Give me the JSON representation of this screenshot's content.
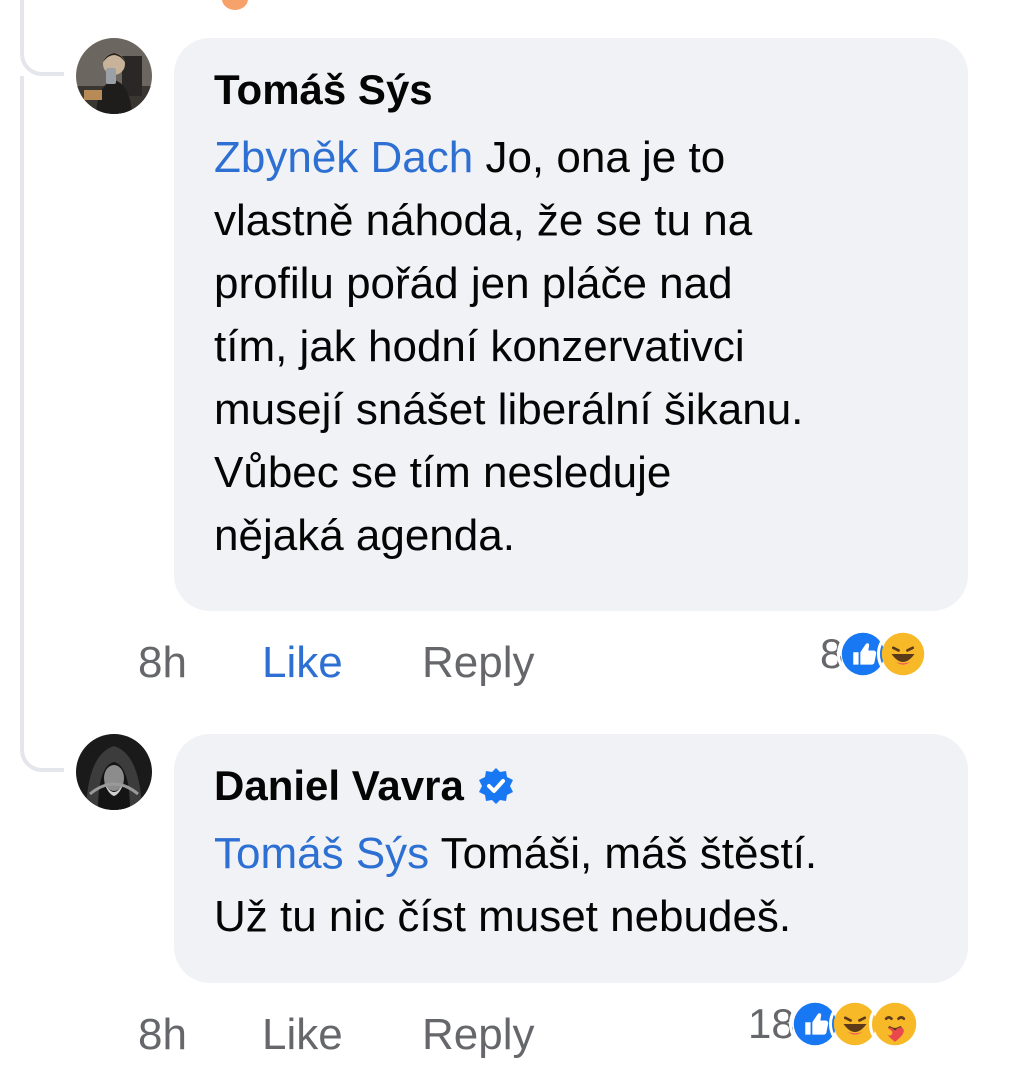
{
  "comments": [
    {
      "author": "Tomáš Sýs",
      "mention": "Zbyněk Dach",
      "body": " Jo, ona je to\nvlastně náhoda, že se tu na\nprofilu pořád jen pláče nad\ntím, jak hodní konzervativci\nmusejí snášet liberální šikanu.\nVůbec se tím nesleduje\nnějaká agenda.",
      "time": "8h",
      "like_label": "Like",
      "reply_label": "Reply",
      "reaction_count": "8",
      "reactions": [
        "like-icon",
        "haha-icon"
      ],
      "liked": true,
      "verified": false
    },
    {
      "author": "Daniel Vavra",
      "mention": "Tomáš Sýs",
      "body": " Tomáši, máš štěstí.\nUž tu nic číst muset nebudeš.",
      "time": "8h",
      "like_label": "Like",
      "reply_label": "Reply",
      "reaction_count": "18",
      "reactions": [
        "like-icon",
        "haha-icon",
        "care-icon"
      ],
      "liked": false,
      "verified": true
    }
  ],
  "colors": {
    "mention": "#2d6fd2",
    "bubble": "#f0f2f5",
    "meta": "#65676b",
    "like_blue": "#1877f2",
    "emoji_yellow": "#f7b928"
  }
}
